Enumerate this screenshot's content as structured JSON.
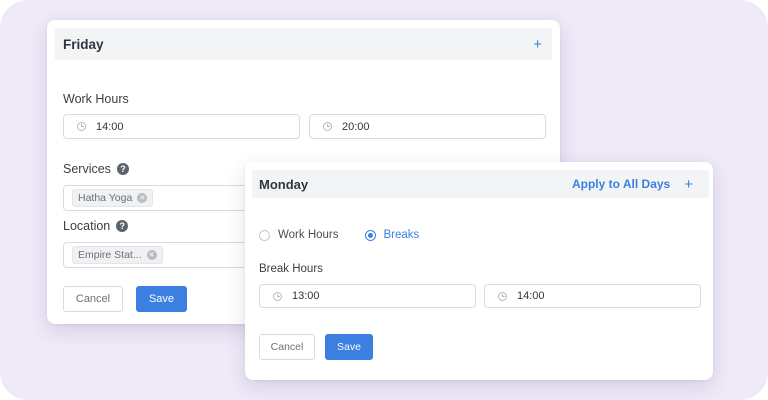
{
  "colors": {
    "accent": "#3b7fe0",
    "background": "#efe9f8",
    "header_bg": "#f3f4f6"
  },
  "friday": {
    "title": "Friday",
    "add_icon": "plus-icon",
    "work_hours_label": "Work Hours",
    "start_time": "14:00",
    "end_time": "20:00",
    "services_label": "Services",
    "services_tags": [
      "Hatha Yoga"
    ],
    "location_label": "Location",
    "location_tags": [
      "Empire Stat..."
    ],
    "cancel_label": "Cancel",
    "save_label": "Save"
  },
  "monday": {
    "title": "Monday",
    "apply_all_label": "Apply to All Days",
    "add_icon": "plus-icon",
    "radio_work_hours": "Work Hours",
    "radio_breaks": "Breaks",
    "selected_radio": "Breaks",
    "break_hours_label": "Break Hours",
    "break_start": "13:00",
    "break_end": "14:00",
    "cancel_label": "Cancel",
    "save_label": "Save"
  }
}
